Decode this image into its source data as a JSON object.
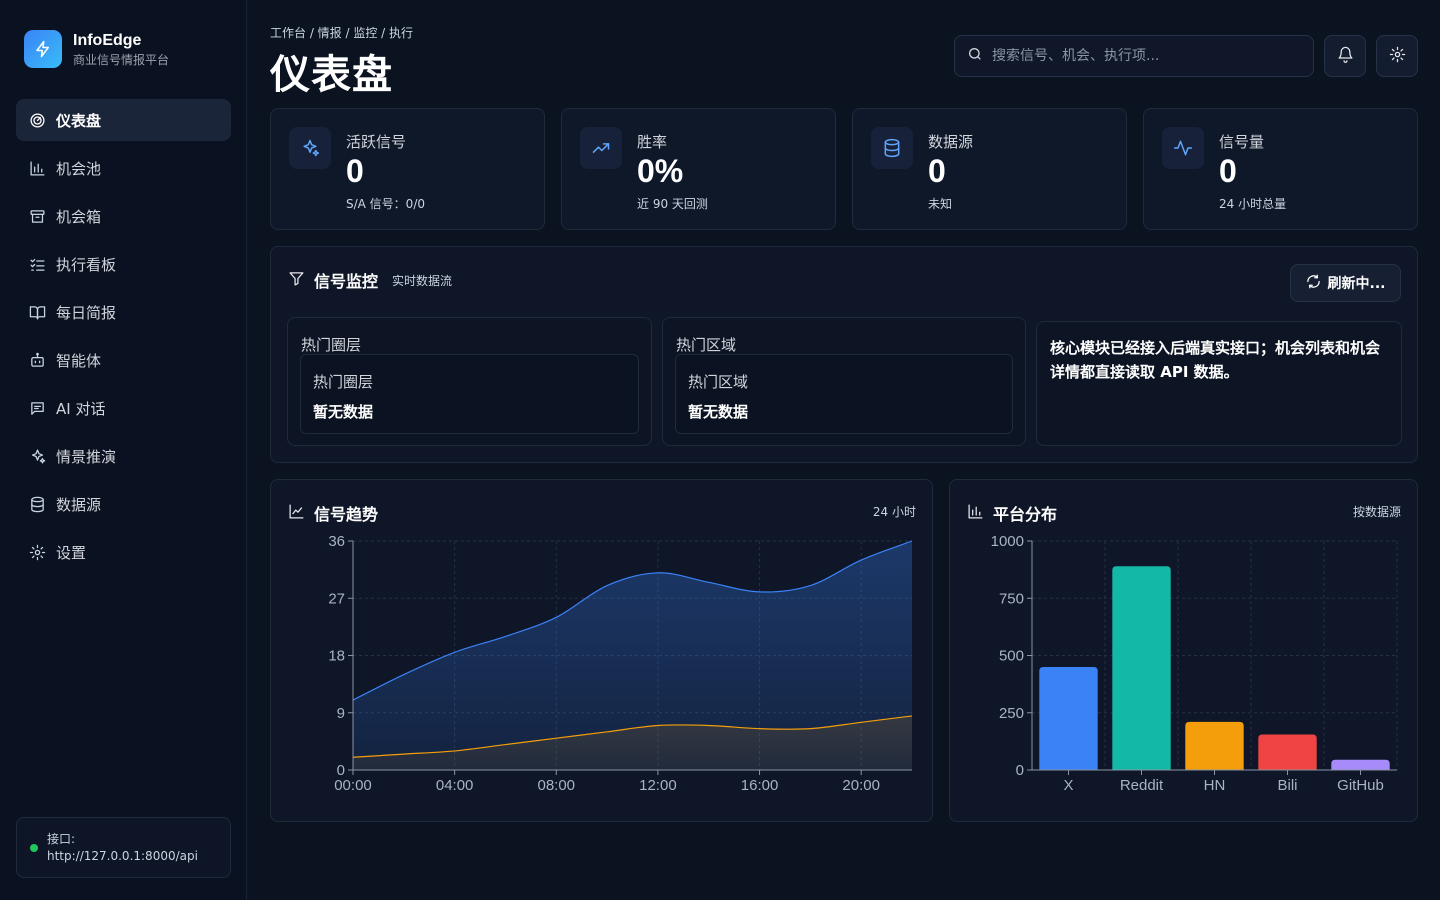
{
  "brand": {
    "name": "InfoEdge",
    "subtitle": "商业信号情报平台"
  },
  "nav": [
    {
      "label": "仪表盘",
      "icon": "gauge-icon",
      "active": true
    },
    {
      "label": "机会池",
      "icon": "bar-chart-icon"
    },
    {
      "label": "机会箱",
      "icon": "archive-box-icon"
    },
    {
      "label": "执行看板",
      "icon": "list-checks-icon"
    },
    {
      "label": "每日简报",
      "icon": "book-open-icon"
    },
    {
      "label": "智能体",
      "icon": "bot-icon"
    },
    {
      "label": "AI 对话",
      "icon": "message-square-icon"
    },
    {
      "label": "情景推演",
      "icon": "sparkles-icon"
    },
    {
      "label": "数据源",
      "icon": "database-icon"
    },
    {
      "label": "设置",
      "icon": "gear-icon"
    }
  ],
  "api": {
    "label": "接口:",
    "url": "http://127.0.0.1:8000/api",
    "status_color": "#22c55e"
  },
  "header": {
    "breadcrumb": "工作台 / 情报 / 监控 / 执行",
    "title": "仪表盘",
    "search_placeholder": "搜索信号、机会、执行项..."
  },
  "stats": [
    {
      "label": "活跃信号",
      "value": "0",
      "sub": "S/A 信号：0/0",
      "icon": "sparkles-icon"
    },
    {
      "label": "胜率",
      "value": "0%",
      "sub": "近 90 天回测",
      "icon": "trending-up-icon"
    },
    {
      "label": "数据源",
      "value": "0",
      "sub": "未知",
      "icon": "database-icon"
    },
    {
      "label": "信号量",
      "value": "0",
      "sub": "24 小时总量",
      "icon": "activity-icon"
    }
  ],
  "monitor": {
    "title": "信号监控",
    "subtitle": "实时数据流",
    "refresh_label": "刷新中...",
    "hot_layers": {
      "title": "热门圈层",
      "inner_title": "热门圈层",
      "value": "暂无数据"
    },
    "hot_regions": {
      "title": "热门区域",
      "inner_title": "热门区域",
      "value": "暂无数据"
    },
    "note": "核心模块已经接入后端真实接口；机会列表和机会详情都直接读取 API 数据。"
  },
  "trend": {
    "title": "信号趋势",
    "range": "24 小时"
  },
  "platform": {
    "title": "平台分布",
    "range": "按数据源"
  },
  "colors": {
    "accent": "#3b82f6",
    "orange": "#f59e0b",
    "background": "#0b1220",
    "panel": "#0e1627"
  },
  "chart_data": [
    {
      "type": "area",
      "x": [
        "00:00",
        "02:00",
        "04:00",
        "06:00",
        "08:00",
        "10:00",
        "12:00",
        "14:00",
        "16:00",
        "18:00",
        "20:00",
        "22:00"
      ],
      "series": [
        {
          "values": [
            11,
            15,
            18.5,
            21,
            24,
            29,
            31,
            29.5,
            28,
            29,
            33,
            36
          ],
          "color": "#3b82f6"
        },
        {
          "values": [
            2,
            2.5,
            3,
            4,
            5,
            6,
            7,
            7,
            6.5,
            6.5,
            7.5,
            8.5
          ],
          "color": "#f59e0b"
        }
      ],
      "xticks": [
        "00:00",
        "04:00",
        "08:00",
        "12:00",
        "16:00",
        "20:00"
      ],
      "yticks": [
        0,
        9,
        18,
        27,
        36
      ],
      "ylim": [
        0,
        36
      ],
      "grid": true
    },
    {
      "type": "bar",
      "categories": [
        "X",
        "Reddit",
        "HN",
        "Bili",
        "GitHub"
      ],
      "values": [
        450,
        890,
        210,
        155,
        45
      ],
      "colors": [
        "#3b82f6",
        "#14b8a6",
        "#f59e0b",
        "#ef4444",
        "#a78bfa"
      ],
      "yticks": [
        0,
        250,
        500,
        750,
        1000
      ],
      "ylim": [
        0,
        1000
      ],
      "grid": true
    }
  ]
}
